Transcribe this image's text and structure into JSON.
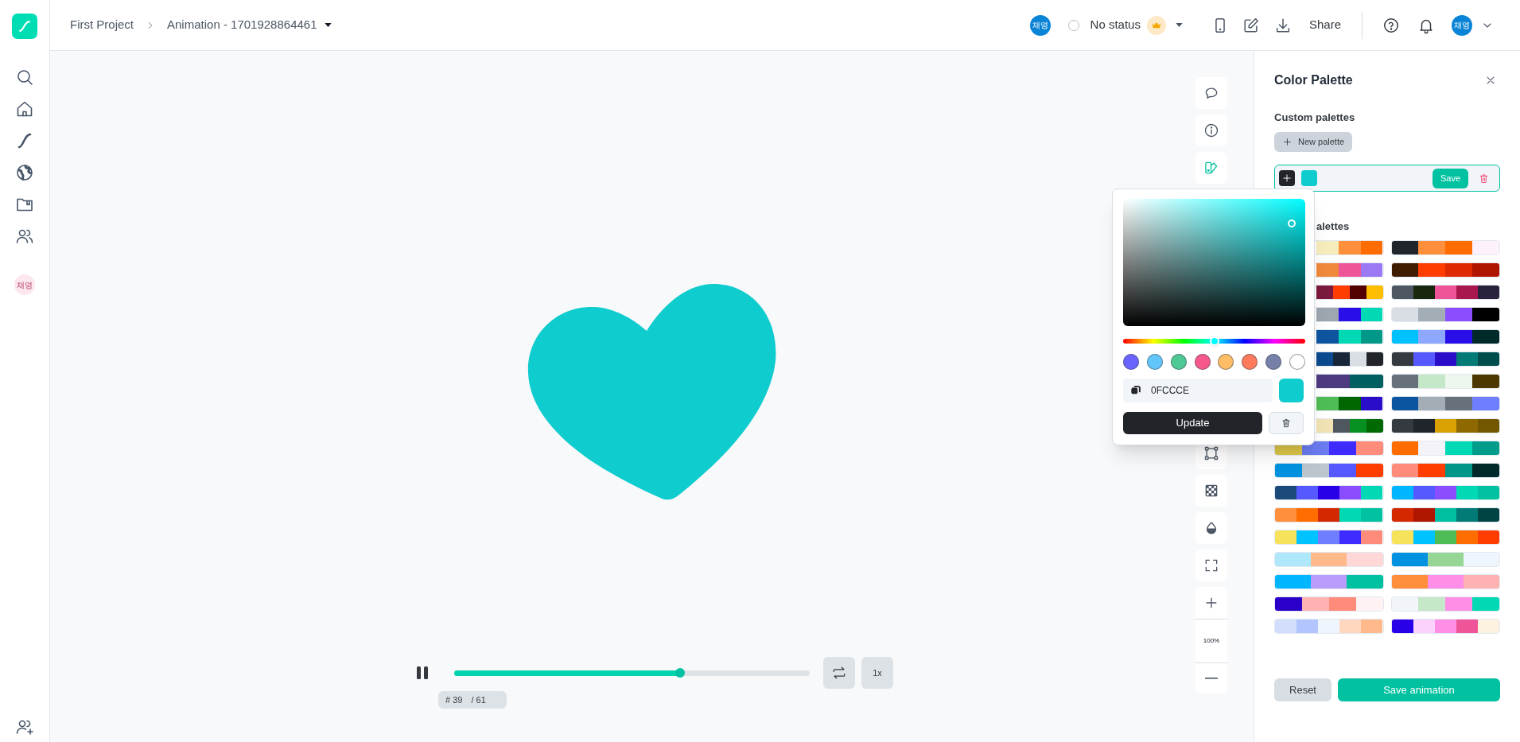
{
  "sidebar": {
    "avatar": "채영"
  },
  "breadcrumb": [
    "First Project",
    "Animation - 1701928864461"
  ],
  "header": {
    "avatar": "채영",
    "status_checked": false,
    "status": "No status",
    "share": "Share",
    "user_avatar": "채영"
  },
  "toolbar": {
    "top_buttons": [
      {
        "kind": "comment",
        "selected": false
      },
      {
        "kind": "info",
        "selected": false
      },
      {
        "kind": "palette",
        "selected": true
      }
    ],
    "bottom_buttons": [
      {
        "kind": "transform",
        "selected": false
      },
      {
        "kind": "background",
        "selected": false
      },
      {
        "kind": "opacity",
        "selected": false
      },
      {
        "kind": "fullscreen",
        "selected": false
      }
    ],
    "zoom": "100%"
  },
  "player": {
    "playing": true,
    "level": 0.635,
    "speed": "1x",
    "frame": "# 39",
    "total": "/ 61"
  },
  "heart": {
    "color": "#0fccce"
  },
  "color_picker": {
    "value": "0FCCCE",
    "presets": [
      {
        "color": "#6b63ff"
      },
      {
        "color": "#62c6fa"
      },
      {
        "color": "#4fc994"
      },
      {
        "color": "#f7588c"
      },
      {
        "color": "#ffbd66"
      },
      {
        "color": "#ff7a5c"
      },
      {
        "color": "#7780a8"
      },
      {
        "color": "#ffffff"
      }
    ],
    "update": "Update"
  },
  "panel": {
    "title": "Color Palette",
    "custom_heading": "Custom palettes",
    "new_palette": "New palette",
    "custom_palette": {
      "colors": [
        {
          "color": "#0fccce"
        }
      ],
      "save": "Save"
    },
    "presets_heading": "alettes",
    "palettes": [
      {
        "colors": [
          {
            "color": "#f6ecbc"
          },
          {
            "color": "#ff8f3a"
          },
          {
            "color": "#ff6d00"
          }
        ]
      },
      {
        "colors": [
          {
            "color": "#1f252b"
          },
          {
            "color": "#ff8f3a"
          },
          {
            "color": "#ff6d00"
          },
          {
            "color": "#fdf2fb"
          }
        ]
      },
      {
        "colors": [
          {
            "color": "#f0893a"
          },
          {
            "color": "#ee5598"
          },
          {
            "color": "#9b79f4"
          }
        ]
      },
      {
        "colors": [
          {
            "color": "#3f1b00"
          },
          {
            "color": "#ff3d00"
          },
          {
            "color": "#dd2a00"
          },
          {
            "color": "#b01500"
          }
        ]
      },
      {
        "colors": [
          {
            "color": "#7b1a3e"
          },
          {
            "color": "#ff3d00"
          },
          {
            "color": "#520000"
          },
          {
            "color": "#ffbe00"
          }
        ]
      },
      {
        "colors": [
          {
            "color": "#4d5761"
          },
          {
            "color": "#17280e"
          },
          {
            "color": "#ee5598"
          },
          {
            "color": "#a8174e"
          },
          {
            "color": "#2a213d"
          }
        ]
      },
      {
        "colors": [
          {
            "color": "#9ea7b0"
          },
          {
            "color": "#2a0ee8"
          },
          {
            "color": "#00d9b4"
          }
        ]
      },
      {
        "colors": [
          {
            "color": "#d8dee4"
          },
          {
            "color": "#a3adb5"
          },
          {
            "color": "#8a4dff"
          },
          {
            "color": "#000000"
          }
        ]
      },
      {
        "colors": [
          {
            "color": "#0e55a0"
          },
          {
            "color": "#00d9b4"
          },
          {
            "color": "#019888"
          }
        ]
      },
      {
        "colors": [
          {
            "color": "#00c2ff"
          },
          {
            "color": "#8fa8ff"
          },
          {
            "color": "#2a0ee8"
          },
          {
            "color": "#002a2a"
          }
        ]
      },
      {
        "colors": [
          {
            "color": "#0b4a8f"
          },
          {
            "color": "#18263a"
          },
          {
            "color": "#d8dee4"
          },
          {
            "color": "#212529"
          }
        ]
      },
      {
        "colors": [
          {
            "color": "#343a40"
          },
          {
            "color": "#5559ff"
          },
          {
            "color": "#2a0dc8"
          },
          {
            "color": "#027a76"
          },
          {
            "color": "#004d4d"
          }
        ]
      },
      {
        "colors": [
          {
            "color": "#4e3a7f"
          },
          {
            "color": "#006060"
          }
        ]
      },
      {
        "colors": [
          {
            "color": "#66717c"
          },
          {
            "color": "#c5e8c8"
          },
          {
            "color": "#eef7ee"
          },
          {
            "color": "#4d3800"
          }
        ]
      },
      {
        "colors": [
          {
            "color": "#4fbd55"
          },
          {
            "color": "#006600"
          },
          {
            "color": "#2a0dc8"
          }
        ]
      },
      {
        "colors": [
          {
            "color": "#0b55a0"
          },
          {
            "color": "#a3adb5"
          },
          {
            "color": "#66717c"
          },
          {
            "color": "#6f7eff"
          }
        ]
      },
      {
        "colors": [
          {
            "color": "#f1e3b3"
          },
          {
            "color": "#4e565e"
          },
          {
            "color": "#079022"
          },
          {
            "color": "#006a00"
          }
        ]
      },
      {
        "colors": [
          {
            "color": "#343a40"
          },
          {
            "color": "#1f252b"
          },
          {
            "color": "#d9a200"
          },
          {
            "color": "#8e6800"
          },
          {
            "color": "#725600"
          }
        ]
      },
      {
        "colors": [
          {
            "color": "#dfc84a"
          },
          {
            "color": "#6b7bf0"
          },
          {
            "color": "#3f2bff"
          },
          {
            "color": "#ff8c7a"
          }
        ]
      },
      {
        "colors": [
          {
            "color": "#ff6d00"
          },
          {
            "color": "#f3f3f9"
          },
          {
            "color": "#00d9b4"
          },
          {
            "color": "#029c8a"
          }
        ]
      },
      {
        "colors": [
          {
            "color": "#0092e0"
          },
          {
            "color": "#bcc5ce"
          },
          {
            "color": "#5559ff"
          },
          {
            "color": "#ff3d00"
          }
        ]
      },
      {
        "colors": [
          {
            "color": "#ff8c7a"
          },
          {
            "color": "#ff3d00"
          },
          {
            "color": "#029688"
          },
          {
            "color": "#002a2a"
          }
        ]
      },
      {
        "colors": [
          {
            "color": "#1b4a7a"
          },
          {
            "color": "#5559ff"
          },
          {
            "color": "#2a00e8"
          },
          {
            "color": "#8a4dff"
          },
          {
            "color": "#00d9b4"
          }
        ]
      },
      {
        "colors": [
          {
            "color": "#00b6ff"
          },
          {
            "color": "#5559ff"
          },
          {
            "color": "#8a4dff"
          },
          {
            "color": "#00d9b4"
          },
          {
            "color": "#00c2a0"
          }
        ]
      },
      {
        "colors": [
          {
            "color": "#ff8f3a"
          },
          {
            "color": "#ff6d00"
          },
          {
            "color": "#d52800"
          },
          {
            "color": "#00d9b4"
          },
          {
            "color": "#00c2a0"
          }
        ]
      },
      {
        "colors": [
          {
            "color": "#d52800"
          },
          {
            "color": "#b01500"
          },
          {
            "color": "#00bfa0"
          },
          {
            "color": "#027a76"
          },
          {
            "color": "#004444"
          }
        ]
      },
      {
        "colors": [
          {
            "color": "#f7e35a"
          },
          {
            "color": "#00c2ff"
          },
          {
            "color": "#6f7eff"
          },
          {
            "color": "#3f2bff"
          },
          {
            "color": "#ff8c7a"
          }
        ]
      },
      {
        "colors": [
          {
            "color": "#f7e35a"
          },
          {
            "color": "#00c2ff"
          },
          {
            "color": "#4fbd55"
          },
          {
            "color": "#ff6d00"
          },
          {
            "color": "#ff3d00"
          }
        ]
      },
      {
        "colors": [
          {
            "color": "#b0e8fb"
          },
          {
            "color": "#ffb98a"
          },
          {
            "color": "#ffd7d7"
          }
        ]
      },
      {
        "colors": [
          {
            "color": "#0092e0"
          },
          {
            "color": "#95d695"
          },
          {
            "color": "#eef5fd"
          }
        ]
      },
      {
        "colors": [
          {
            "color": "#00b6ff"
          },
          {
            "color": "#b99cf9"
          },
          {
            "color": "#00c2a0"
          }
        ]
      },
      {
        "colors": [
          {
            "color": "#ff8f3a"
          },
          {
            "color": "#ff8fe6"
          },
          {
            "color": "#ffb2b2"
          }
        ]
      },
      {
        "colors": [
          {
            "color": "#2a00c8"
          },
          {
            "color": "#ffb2b2"
          },
          {
            "color": "#ff8c7a"
          },
          {
            "color": "#fff2f2"
          }
        ]
      },
      {
        "colors": [
          {
            "color": "#f1f5f9"
          },
          {
            "color": "#c5e8c8"
          },
          {
            "color": "#ff8fe6"
          },
          {
            "color": "#00d9b4"
          }
        ]
      },
      {
        "colors": [
          {
            "color": "#d2defc"
          },
          {
            "color": "#b2c5ff"
          },
          {
            "color": "#eef5fd"
          },
          {
            "color": "#ffd7bf"
          },
          {
            "color": "#ffb98a"
          }
        ]
      },
      {
        "colors": [
          {
            "color": "#2a00e8"
          },
          {
            "color": "#fad2fb"
          },
          {
            "color": "#ff8fe6"
          },
          {
            "color": "#ee5598"
          },
          {
            "color": "#fdf2e0"
          }
        ]
      }
    ],
    "reset": "Reset",
    "save_animation": "Save animation"
  }
}
